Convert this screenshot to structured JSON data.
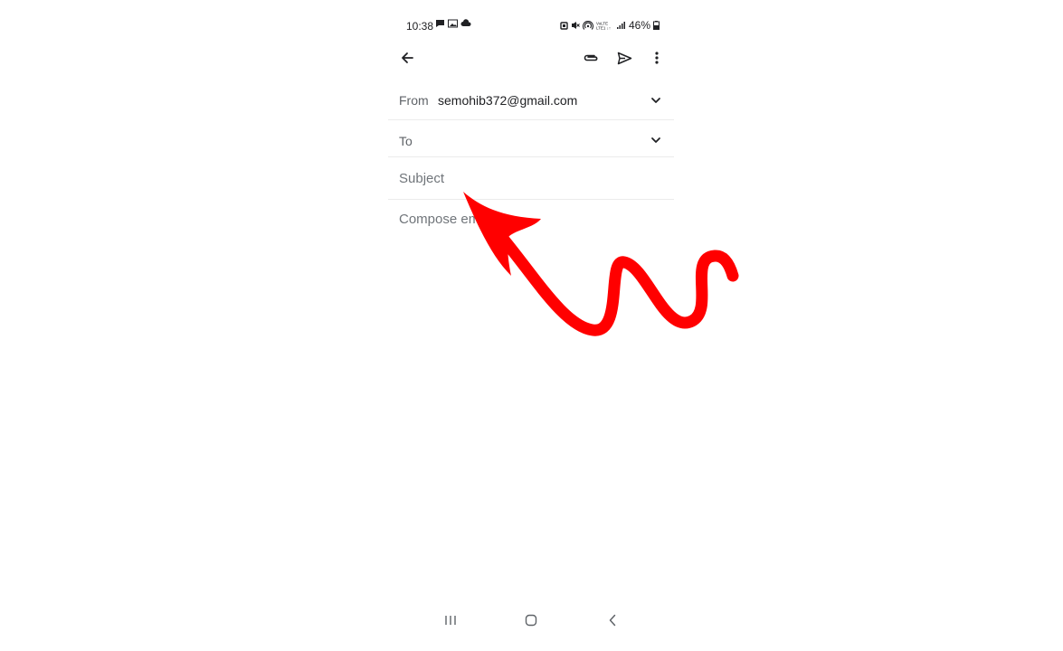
{
  "status_bar": {
    "time": "10:38",
    "battery": "46%",
    "network_label": "VoLTE LTE1"
  },
  "app_bar": {
    "back_icon": "arrow-left-icon",
    "attach_icon": "paperclip-icon",
    "send_icon": "send-icon",
    "more_icon": "more-vertical-icon"
  },
  "compose": {
    "from_label": "From",
    "from_value": "semohib372@gmail.com",
    "to_label": "To",
    "to_value": "",
    "subject_placeholder": "Subject",
    "body_placeholder": "Compose email"
  },
  "annotation": {
    "arrow_color": "#ff0000"
  },
  "colors": {
    "text_primary": "#202124",
    "text_secondary": "#5f6368",
    "divider": "#ececec",
    "background": "#ffffff"
  }
}
